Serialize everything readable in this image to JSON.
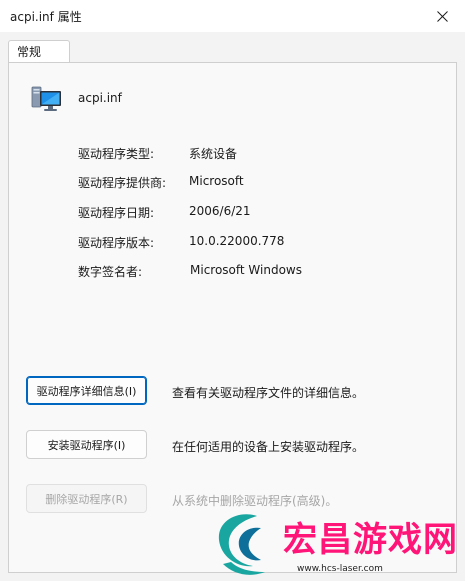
{
  "window": {
    "title": "acpi.inf 属性",
    "close_icon": "close-icon"
  },
  "tabs": [
    {
      "label": "常规",
      "active": true
    }
  ],
  "file": {
    "icon": "computer-monitor-icon",
    "name": "acpi.inf"
  },
  "properties": [
    {
      "label": "驱动程序类型:",
      "value": "系统设备"
    },
    {
      "label": "驱动程序提供商:",
      "value": "Microsoft"
    },
    {
      "label": "驱动程序日期:",
      "value": "2006/6/21"
    },
    {
      "label": "驱动程序版本:",
      "value": "10.0.22000.778"
    },
    {
      "label": "数字签名者:",
      "value": "Microsoft Windows"
    }
  ],
  "actions": [
    {
      "button": "驱动程序详细信息(I)",
      "description": "查看有关驱动程序文件的详细信息。",
      "enabled": true,
      "focused": true
    },
    {
      "button": "安装驱动程序(I)",
      "description": "在任何适用的设备上安装驱动程序。",
      "enabled": true,
      "focused": false
    },
    {
      "button": "删除驱动程序(R)",
      "description": "从系统中删除驱动程序(高级)。",
      "enabled": false,
      "focused": false
    }
  ],
  "watermark": {
    "text": "宏昌游戏网",
    "url": "www.hcs-laser.com",
    "color": "#ff1478"
  }
}
